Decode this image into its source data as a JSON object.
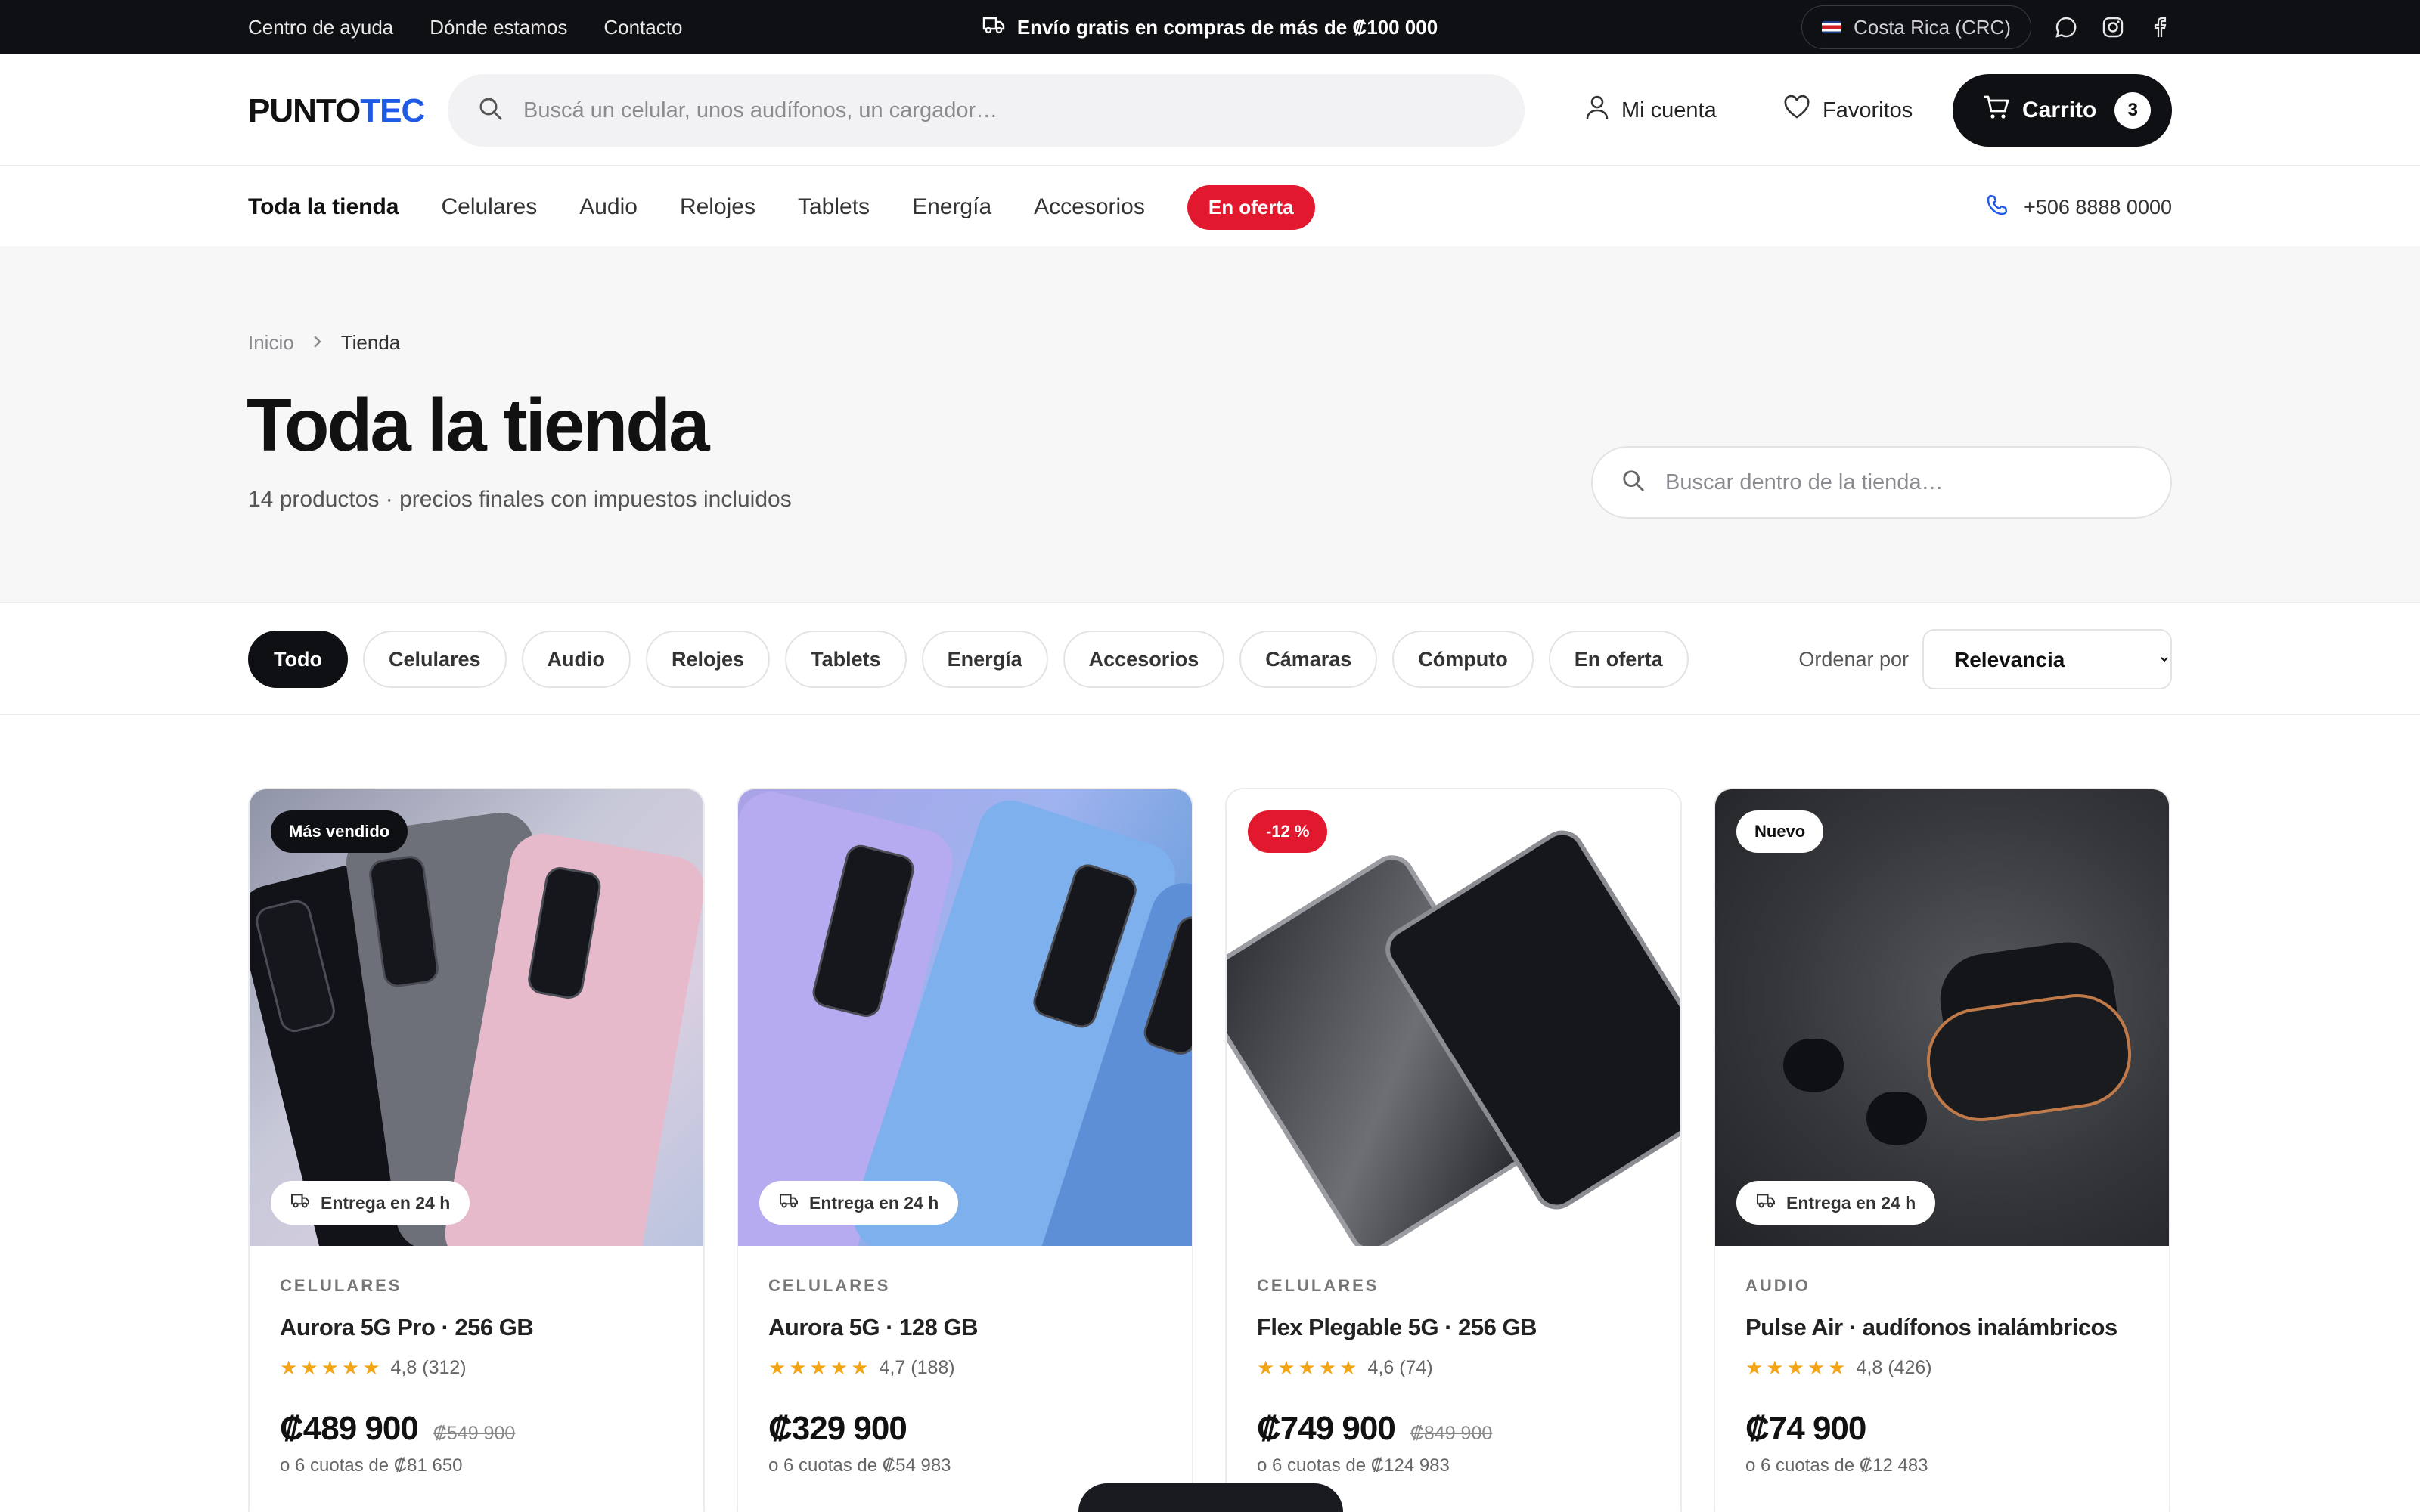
{
  "topbar": {
    "links": [
      "Centro de ayuda",
      "Dónde estamos",
      "Contacto"
    ],
    "promo": "Envío gratis en compras de más de ₡100 000",
    "currency": "Costa Rica (CRC)"
  },
  "header": {
    "logo_a": "PUNTO",
    "logo_b": "TEC",
    "search_placeholder": "Buscá un celular, unos audífonos, un cargador…",
    "account": "Mi cuenta",
    "favorites": "Favoritos",
    "cart": "Carrito",
    "cart_count": "3"
  },
  "nav": {
    "items": [
      "Toda la tienda",
      "Celulares",
      "Audio",
      "Relojes",
      "Tablets",
      "Energía",
      "Accesorios"
    ],
    "sale": "En oferta",
    "phone": "+506 8888 0000"
  },
  "hero": {
    "crumbs": [
      "Inicio",
      "Tienda"
    ],
    "title": "Toda la tienda",
    "subtitle": "14 productos · precios finales con impuestos incluidos",
    "search_placeholder": "Buscar dentro de la tienda…"
  },
  "filters": {
    "chips": [
      "Todo",
      "Celulares",
      "Audio",
      "Relojes",
      "Tablets",
      "Energía",
      "Accesorios",
      "Cámaras",
      "Cómputo",
      "En oferta"
    ],
    "sort_label": "Ordenar por",
    "sort_value": "Relevancia"
  },
  "products": [
    {
      "badge": "Más vendido",
      "delivery": "Entrega en 24 h",
      "category": "CELULARES",
      "name": "Aurora 5G Pro · 256 GB",
      "stars": "★★★★★",
      "rating": "4,8 (312)",
      "price": "₡489 900",
      "old_price": "₡549 900",
      "quota": "o 6 cuotas de ₡81 650"
    },
    {
      "badge": "",
      "delivery": "Entrega en 24 h",
      "category": "CELULARES",
      "name": "Aurora 5G · 128 GB",
      "stars": "★★★★★",
      "rating": "4,7 (188)",
      "price": "₡329 900",
      "old_price": "",
      "quota": "o 6 cuotas de ₡54 983"
    },
    {
      "badge": "-12 %",
      "delivery": "",
      "category": "CELULARES",
      "name": "Flex Plegable 5G · 256 GB",
      "stars": "★★★★★",
      "rating": "4,6 (74)",
      "price": "₡749 900",
      "old_price": "₡849 900",
      "quota": "o 6 cuotas de ₡124 983"
    },
    {
      "badge": "Nuevo",
      "delivery": "Entrega en 24 h",
      "category": "AUDIO",
      "name": "Pulse Air · audífonos inalámbricos",
      "stars": "★★★★★",
      "rating": "4,8 (426)",
      "price": "₡74 900",
      "old_price": "",
      "quota": "o 6 cuotas de ₡12 483"
    }
  ],
  "colors": {
    "dark": "#0f1014",
    "accent": "#1f5ae6",
    "sale": "#e2182e",
    "star": "#f2a516"
  }
}
